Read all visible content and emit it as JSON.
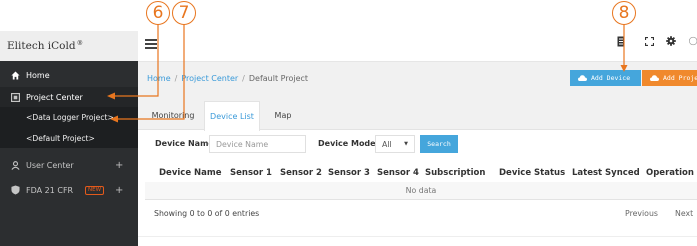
{
  "brand": {
    "name": "Elitech iCold",
    "mark": "®"
  },
  "sidebar": {
    "items": [
      {
        "label": "Home",
        "icon": "home-icon"
      },
      {
        "label": "Project Center",
        "icon": "grid-icon"
      },
      {
        "label": "<Data Logger Project>"
      },
      {
        "label": "<Default Project>"
      },
      {
        "label": "User Center",
        "icon": "user-icon",
        "expand": "+"
      },
      {
        "label": "FDA 21 CFR",
        "icon": "shield-icon",
        "badge": "NEW",
        "expand": "+"
      }
    ]
  },
  "breadcrumb": {
    "items": [
      "Home",
      "Project Center",
      "Default Project"
    ],
    "separator": "/"
  },
  "header_buttons": {
    "add_device": "Add Device",
    "add_project": "Add Project"
  },
  "tabs": [
    "Monitoring",
    "Device List",
    "Map"
  ],
  "active_tab": "Device List",
  "filters": {
    "device_name_label": "Device Name:",
    "device_name_placeholder": "Device Name",
    "device_model_label": "Device Model :",
    "device_model_value": "All",
    "search_label": "Search"
  },
  "table": {
    "columns": [
      "Device Name",
      "Sensor 1",
      "Sensor 2",
      "Sensor 3",
      "Sensor 4",
      "Subscription",
      "Device Status",
      "Latest Synced",
      "Operation"
    ],
    "empty_text": "No data",
    "info": "Showing 0 to 0 of 0 entries",
    "previous": "Previous",
    "next": "Next"
  },
  "annotations": [
    "6",
    "7",
    "8"
  ],
  "colors": {
    "accent": "#45a6dc",
    "orange": "#f0892d",
    "callout": "#e8761f",
    "sidebar": "#2c2e30"
  }
}
